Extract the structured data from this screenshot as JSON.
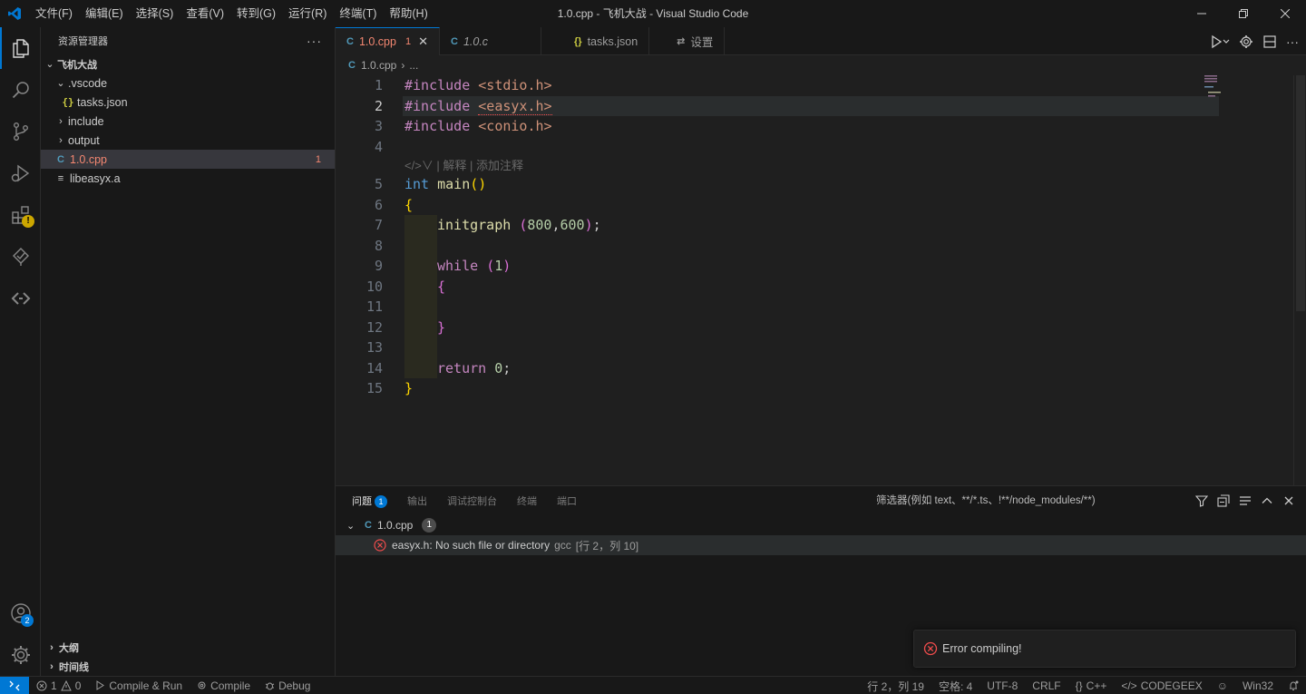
{
  "window": {
    "title": "1.0.cpp - 飞机大战 - Visual Studio Code"
  },
  "menu": [
    "文件(F)",
    "编辑(E)",
    "选择(S)",
    "查看(V)",
    "转到(G)",
    "运行(R)",
    "终端(T)",
    "帮助(H)"
  ],
  "sidebar": {
    "title": "资源管理器",
    "more": "···",
    "folder": "飞机大战",
    "items": [
      {
        "label": ".vscode",
        "type": "folder-open"
      },
      {
        "label": "tasks.json",
        "type": "json"
      },
      {
        "label": "include",
        "type": "folder"
      },
      {
        "label": "output",
        "type": "folder"
      },
      {
        "label": "1.0.cpp",
        "type": "cpp",
        "errors": "1"
      },
      {
        "label": "libeasyx.a",
        "type": "file"
      }
    ],
    "outline": "大纲",
    "timeline": "时间线"
  },
  "activity": {
    "accounts_badge": "2",
    "extensions_warn": "!"
  },
  "tabs": [
    {
      "icon": "C",
      "label": "1.0.cpp",
      "errors": "1",
      "active": true
    },
    {
      "icon": "C",
      "label": "1.0.c",
      "italic": true
    },
    {
      "icon": "{}",
      "label": "tasks.json"
    },
    {
      "icon": "⇄",
      "label": "设置"
    }
  ],
  "breadcrumb": {
    "file": "1.0.cpp",
    "sep": "›",
    "rest": "..."
  },
  "editor": {
    "line_numbers": [
      "1",
      "2",
      "3",
      "4",
      "5",
      "6",
      "7",
      "8",
      "9",
      "10",
      "11",
      "12",
      "13",
      "14",
      "15"
    ],
    "codelens": "| 解释 | 添加注释",
    "codelens_icon": "</>∨",
    "lines": {
      "l1_pp": "#include",
      "l1_inc": " <stdio.h>",
      "l2_pp": "#include",
      "l2_inc_a": " ",
      "l2_inc_b": "<easyx.h>",
      "l3_pp": "#include",
      "l3_inc": " <conio.h>",
      "l5_kw": "int",
      "l5_fn": " main",
      "l5_br": "()",
      "l6_br": "{",
      "l7_fn": "initgraph",
      "l7_sp": " ",
      "l7_br1": "(",
      "l7_n1": "800",
      "l7_c": ",",
      "l7_n2": "600",
      "l7_br2": ")",
      "l7_end": ";",
      "l9_kw": "while",
      "l9_sp": " ",
      "l9_br1": "(",
      "l9_n": "1",
      "l9_br2": ")",
      "l10_br": "{",
      "l12_br": "}",
      "l14_kw": "return",
      "l14_sp": " ",
      "l14_n": "0",
      "l14_end": ";",
      "l15_br": "}"
    }
  },
  "panel": {
    "tabs": [
      "问题",
      "输出",
      "调试控制台",
      "终端",
      "端口"
    ],
    "problems_badge": "1",
    "filter_placeholder": "筛选器(例如 text、**/*.ts、!**/node_modules/**)",
    "file": "1.0.cpp",
    "file_count": "1",
    "problem": {
      "message": "easyx.h: No such file or directory",
      "source": "gcc",
      "location": "[行 2，列 10]"
    }
  },
  "toast": {
    "message": "Error compiling!"
  },
  "status": {
    "errors": "1",
    "warnings": "0",
    "compile_run": "Compile & Run",
    "compile": "Compile",
    "debug": "Debug",
    "position": "行 2，列 19",
    "spaces": "空格: 4",
    "encoding": "UTF-8",
    "eol": "CRLF",
    "language": "C++",
    "codegeex": "CODEGEEX",
    "platform": "Win32"
  },
  "colors": {
    "accent": "#0078d4",
    "error": "#f14c4c",
    "warning": "#cca700"
  }
}
